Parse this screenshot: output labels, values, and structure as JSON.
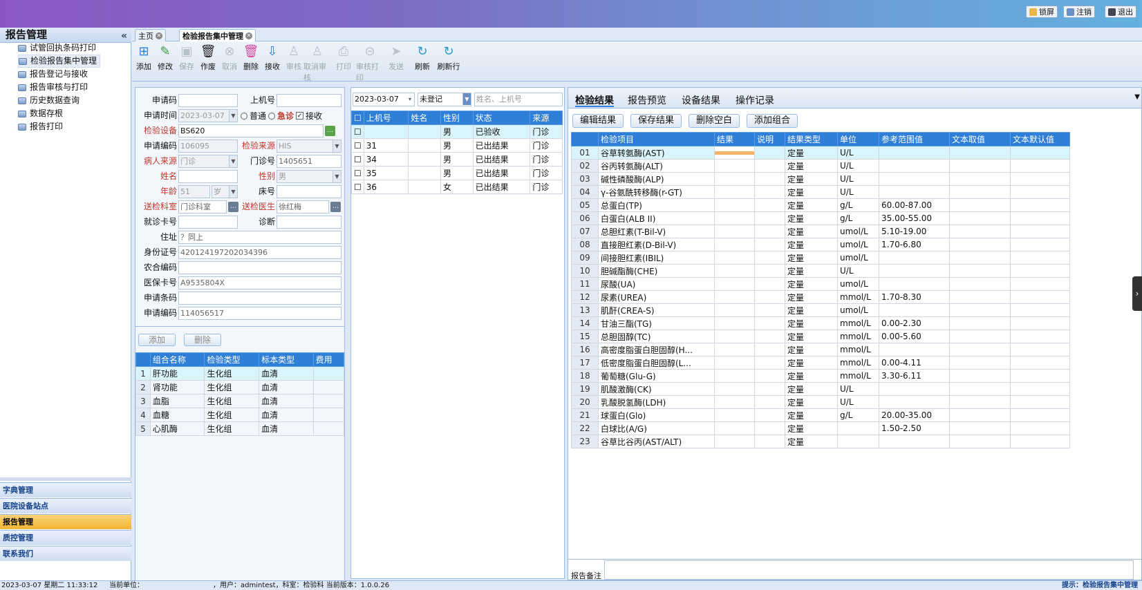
{
  "topbar": {
    "lock": "锁屏",
    "logout": "注销",
    "exit": "退出"
  },
  "sidebar": {
    "title": "报告管理",
    "collapse": "«",
    "items": [
      {
        "label": "试管回执条码打印"
      },
      {
        "label": "检验报告集中管理"
      },
      {
        "label": "报告登记与接收"
      },
      {
        "label": "报告审核与打印"
      },
      {
        "label": "历史数据查询"
      },
      {
        "label": "数据存根"
      },
      {
        "label": "报告打印"
      }
    ],
    "accordion": [
      {
        "label": "字典管理"
      },
      {
        "label": "医院设备站点"
      },
      {
        "label": "报告管理"
      },
      {
        "label": "质控管理"
      },
      {
        "label": "联系我们"
      }
    ]
  },
  "tabs": {
    "home": "主页",
    "current": "检验报告集中管理"
  },
  "toolbar": [
    {
      "label": "添加",
      "icon": "add-icon",
      "enabled": true
    },
    {
      "label": "修改",
      "icon": "edit-icon",
      "enabled": true
    },
    {
      "label": "保存",
      "icon": "save-icon",
      "enabled": false
    },
    {
      "label": "作废",
      "icon": "trash-icon",
      "enabled": true
    },
    {
      "label": "取消",
      "icon": "cancel-icon",
      "enabled": false
    },
    {
      "label": "删除",
      "icon": "delete-icon",
      "enabled": true
    },
    {
      "label": "接收",
      "icon": "receive-icon",
      "enabled": true
    },
    {
      "label": "审核",
      "icon": "audit-icon",
      "enabled": false
    },
    {
      "label": "取消审核",
      "icon": "unaudit-icon",
      "enabled": false
    },
    {
      "label": "打印",
      "icon": "print-icon",
      "enabled": false
    },
    {
      "label": "审核打印",
      "icon": "audit-print-icon",
      "enabled": false
    },
    {
      "label": "发送",
      "icon": "send-icon",
      "enabled": false
    },
    {
      "label": "刷新",
      "icon": "refresh-icon",
      "enabled": true
    },
    {
      "label": "刷新行",
      "icon": "refresh-row-icon",
      "enabled": true
    }
  ],
  "form": {
    "apply_code_label": "申请码",
    "machine_no_label": "上机号",
    "apply_time_label": "申请时间",
    "apply_time": "2023-03-07",
    "normal_label": "普通",
    "urgent_label": "急诊",
    "receive_label": "接收",
    "device_label": "检验设备",
    "device": "BS620",
    "apply_no_label": "申请编码",
    "apply_no": "106095",
    "source_label": "检验来源",
    "source": "HIS",
    "patient_source_label": "病人来源",
    "patient_source": "门诊",
    "clinic_no_label": "门诊号",
    "clinic_no": "1405651",
    "name_label": "姓名",
    "sex_label": "性别",
    "sex": "男",
    "age_label": "年龄",
    "age": "51",
    "age_unit": "岁",
    "bed_label": "床号",
    "dept_label": "送检科室",
    "dept": "门诊科室",
    "doctor_label": "送检医生",
    "doctor": "徐红梅",
    "card_label": "就诊卡号",
    "diagnosis_label": "诊断",
    "address_label": "住址",
    "address": "？同上",
    "id_label": "身份证号",
    "id_no": "420124197202034396",
    "rural_label": "农合编码",
    "insurance_label": "医保卡号",
    "insurance": "A9535804X",
    "barcode_label": "申请条码",
    "apply_code2_label": "申请编码",
    "apply_code2": "114056517",
    "add_btn": "添加",
    "del_btn": "删除"
  },
  "groups": {
    "headers": [
      "组合名称",
      "检验类型",
      "标本类型",
      "费用"
    ],
    "rows": [
      {
        "n": "1",
        "name": "肝功能",
        "type": "生化组",
        "sample": "血清",
        "fee": ""
      },
      {
        "n": "2",
        "name": "肾功能",
        "type": "生化组",
        "sample": "血清",
        "fee": ""
      },
      {
        "n": "3",
        "name": "血脂",
        "type": "生化组",
        "sample": "血清",
        "fee": ""
      },
      {
        "n": "4",
        "name": "血糖",
        "type": "生化组",
        "sample": "血清",
        "fee": ""
      },
      {
        "n": "5",
        "name": "心肌酶",
        "type": "生化组",
        "sample": "血清",
        "fee": ""
      }
    ]
  },
  "list": {
    "date": "2023-03-07",
    "status_filter": "未登记",
    "search_placeholder": "姓名、上机号",
    "headers": [
      "上机号",
      "姓名",
      "性别",
      "状态",
      "来源"
    ],
    "rows": [
      {
        "no": "",
        "name": "",
        "sex": "男",
        "status": "已验收",
        "src": "门诊"
      },
      {
        "no": "31",
        "name": "",
        "sex": "男",
        "status": "已出结果",
        "src": "门诊"
      },
      {
        "no": "34",
        "name": "",
        "sex": "男",
        "status": "已出结果",
        "src": "门诊"
      },
      {
        "no": "35",
        "name": "",
        "sex": "男",
        "status": "已出结果",
        "src": "门诊"
      },
      {
        "no": "36",
        "name": "",
        "sex": "女",
        "status": "已出结果",
        "src": "门诊"
      }
    ]
  },
  "right": {
    "tabs": [
      "检验结果",
      "报告预览",
      "设备结果",
      "操作记录"
    ],
    "buttons": [
      "编辑结果",
      "保存结果",
      "删除空白",
      "添加组合"
    ],
    "headers": [
      "检验项目",
      "结果",
      "说明",
      "结果类型",
      "单位",
      "参考范围值",
      "文本取值",
      "文本默认值"
    ],
    "rows": [
      {
        "n": "01",
        "item": "谷草转氨酶(AST)",
        "type": "定量",
        "unit": "U/L",
        "ref": ""
      },
      {
        "n": "02",
        "item": "谷丙转氨酶(ALT)",
        "type": "定量",
        "unit": "U/L",
        "ref": ""
      },
      {
        "n": "03",
        "item": "碱性磷酸酶(ALP)",
        "type": "定量",
        "unit": "U/L",
        "ref": ""
      },
      {
        "n": "04",
        "item": "γ-谷氨酰转移酶(r-GT)",
        "type": "定量",
        "unit": "U/L",
        "ref": ""
      },
      {
        "n": "05",
        "item": "总蛋白(TP)",
        "type": "定量",
        "unit": "g/L",
        "ref": "60.00-87.00"
      },
      {
        "n": "06",
        "item": "白蛋白(ALB II)",
        "type": "定量",
        "unit": "g/L",
        "ref": "35.00-55.00"
      },
      {
        "n": "07",
        "item": "总胆红素(T-Bil-V)",
        "type": "定量",
        "unit": "umol/L",
        "ref": "5.10-19.00"
      },
      {
        "n": "08",
        "item": "直接胆红素(D-Bil-V)",
        "type": "定量",
        "unit": "umol/L",
        "ref": "1.70-6.80"
      },
      {
        "n": "09",
        "item": "间接胆红素(IBIL)",
        "type": "定量",
        "unit": "umol/L",
        "ref": ""
      },
      {
        "n": "10",
        "item": "胆碱酯酶(CHE)",
        "type": "定量",
        "unit": "U/L",
        "ref": ""
      },
      {
        "n": "11",
        "item": "尿酸(UA)",
        "type": "定量",
        "unit": "umol/L",
        "ref": ""
      },
      {
        "n": "12",
        "item": "尿素(UREA)",
        "type": "定量",
        "unit": "mmol/L",
        "ref": "1.70-8.30"
      },
      {
        "n": "13",
        "item": "肌酐(CREA-S)",
        "type": "定量",
        "unit": "umol/L",
        "ref": ""
      },
      {
        "n": "14",
        "item": "甘油三酯(TG)",
        "type": "定量",
        "unit": "mmol/L",
        "ref": "0.00-2.30"
      },
      {
        "n": "15",
        "item": "总胆固醇(TC)",
        "type": "定量",
        "unit": "mmol/L",
        "ref": "0.00-5.60"
      },
      {
        "n": "16",
        "item": "高密度脂蛋白胆固醇(H...",
        "type": "定量",
        "unit": "mmol/L",
        "ref": ""
      },
      {
        "n": "17",
        "item": "低密度脂蛋白胆固醇(L...",
        "type": "定量",
        "unit": "mmol/L",
        "ref": "0.00-4.11"
      },
      {
        "n": "18",
        "item": "葡萄糖(Glu-G)",
        "type": "定量",
        "unit": "mmol/L",
        "ref": "3.30-6.11"
      },
      {
        "n": "19",
        "item": "肌酸激酶(CK)",
        "type": "定量",
        "unit": "U/L",
        "ref": ""
      },
      {
        "n": "20",
        "item": "乳酸脱氢酶(LDH)",
        "type": "定量",
        "unit": "U/L",
        "ref": ""
      },
      {
        "n": "21",
        "item": "球蛋白(Glo)",
        "type": "定量",
        "unit": "g/L",
        "ref": "20.00-35.00"
      },
      {
        "n": "22",
        "item": "白球比(A/G)",
        "type": "定量",
        "unit": "",
        "ref": "1.50-2.50"
      },
      {
        "n": "23",
        "item": "谷草比谷丙(AST/ALT)",
        "type": "定量",
        "unit": "",
        "ref": ""
      }
    ],
    "remark_label": "报告备注"
  },
  "status": {
    "datetime": "2023-03-07 星期二 11:33:12",
    "unit_label": "当前单位：",
    "user": "，用户：admintest，科室：检验科  当前版本：1.0.0.26",
    "hint": "提示：检验报告集中管理"
  }
}
